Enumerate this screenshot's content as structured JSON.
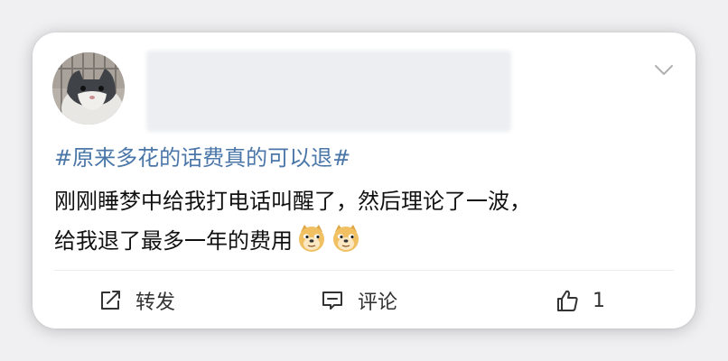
{
  "post": {
    "topic": "#原来多花的话费真的可以退#",
    "lines": [
      "刚刚睡梦中给我打电话叫醒了，然后理论了一波，",
      "给我退了最多一年的费用"
    ],
    "emojis": [
      "doge-emoji",
      "doge-emoji"
    ]
  },
  "actions": {
    "repost_label": "转发",
    "comment_label": "评论",
    "like_count": "1"
  },
  "colors": {
    "topic": "#4a76a8",
    "text": "#111111",
    "icon": "#333333"
  },
  "icons": {
    "more": "chevron-down-icon",
    "repost": "repost-icon",
    "comment": "comment-icon",
    "like": "thumbs-up-icon"
  }
}
